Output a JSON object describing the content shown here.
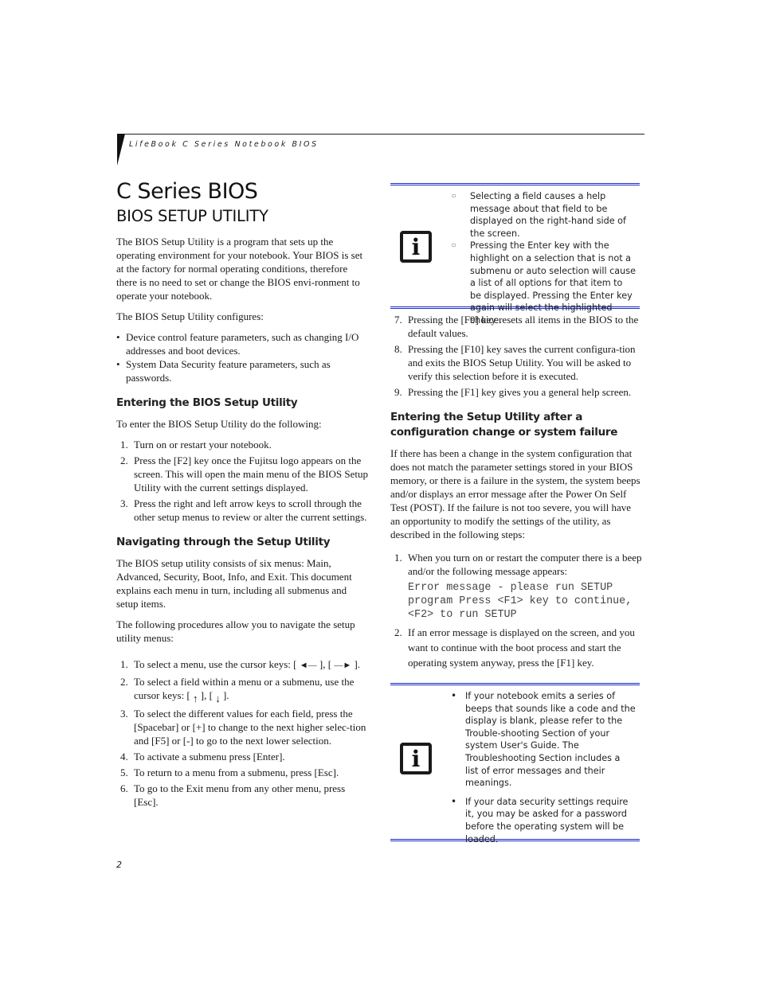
{
  "running_head": "LifeBook C Series Notebook BIOS",
  "page_title": "C Series BIOS",
  "section_title": "BIOS SETUP UTILITY",
  "intro": {
    "p1": "The BIOS Setup Utility is a program that sets up the operating environment for your notebook. Your BIOS is set at the factory for normal operating conditions, therefore there is no need to set or change the BIOS envi-ronment to operate your notebook.",
    "p2": "The BIOS Setup Utility configures:",
    "bullets": [
      "Device control feature parameters, such as changing I/O addresses and boot devices.",
      "System Data Security feature parameters, such as passwords."
    ]
  },
  "entering": {
    "heading": "Entering the BIOS Setup Utility",
    "intro": "To enter the BIOS Setup Utility do the following:",
    "steps": [
      {
        "num": "1.",
        "text": "Turn on or restart your notebook."
      },
      {
        "num": "2.",
        "text": "Press the [F2] key once the Fujitsu logo appears on the screen. This will open the main menu of the BIOS Setup Utility with the current settings displayed."
      },
      {
        "num": "3.",
        "text": "Press the right and left arrow keys to scroll through the other setup menus to review or alter the current settings."
      }
    ]
  },
  "navigating": {
    "heading": "Navigating through the Setup Utility",
    "p1": "The BIOS setup utility consists of six menus: Main, Advanced, Security, Boot, Info, and Exit. This document explains each menu in turn, including all submenus and setup items.",
    "p2": "The following procedures allow you to navigate the setup utility menus:",
    "step1": {
      "num": "1.",
      "text_a": "To select a menu, use the cursor keys: [ ",
      "mid": " ], [ ",
      "text_b": " ]."
    },
    "step2": {
      "num": "2.",
      "text_a": "To select a field within a menu or a submenu, use the cursor keys: [ ",
      "mid": " ], [ ",
      "text_b": " ]."
    },
    "steps": [
      {
        "num": "3.",
        "text": "To select the different values for each field, press the [Spacebar] or [+] to change to the next higher selec-tion and [F5] or [-] to go to the next lower selection."
      },
      {
        "num": "4.",
        "text": "To activate a submenu press [Enter]."
      },
      {
        "num": "5.",
        "text": "To return to a menu from a submenu, press [Esc]."
      },
      {
        "num": "6.",
        "text": "To go to the Exit menu from any other menu, press [Esc]."
      },
      {
        "num": "7.",
        "text": "Pressing the [F9] key resets all items in the BIOS to the default values."
      },
      {
        "num": "8.",
        "text": "Pressing the [F10] key saves the current configura-tion and exits the BIOS Setup Utility. You will be asked to verify this selection before it is executed."
      },
      {
        "num": "9.",
        "text": "Pressing the [F1] key gives you a general help screen."
      }
    ],
    "arrows": {
      "left": "◄—",
      "right": "—►",
      "up": "↑",
      "down": "↓"
    }
  },
  "note1": {
    "icon": "info-icon",
    "icon_glyph": "i",
    "items": [
      "Selecting a field causes a help message about that field to be displayed on the right-hand side of the screen.",
      "Pressing the Enter key with the highlight on a selection that is not a submenu or auto selection will cause a list of all options for that item to be displayed. Pressing the Enter key again will select the highlighted choice."
    ]
  },
  "failure": {
    "heading": "Entering the Setup Utility after a configuration change or system failure",
    "p1": "If there has been a change in the system configuration that does not match the parameter settings stored in your BIOS memory, or there is a failure in the system, the system beeps and/or displays an error message after the Power On Self Test (POST). If the failure is not too severe, you will have an opportunity to modify the settings of the utility, as described in the following steps:",
    "steps": [
      {
        "num": "1.",
        "text": "When you turn on or restart the computer there is a beep and/or the following message appears:"
      },
      {
        "num": "2.",
        "text": "If an error message is displayed on the screen, and you want to continue with the boot process and start the operating system anyway, press the [F1] key."
      }
    ],
    "error_message": "Error message - please run SETUP\nprogram Press <F1> key to continue,\n<F2> to run SETUP"
  },
  "note2": {
    "icon": "info-icon",
    "icon_glyph": "i",
    "items": [
      "If your notebook emits a series of beeps that sounds like a code and the display is blank, please refer to the Trouble-shooting Section of your system User's Guide. The Troubleshooting Section includes a list of error messages and their meanings.",
      "If your data security settings require it, you may be asked for a password before the operating system will be loaded."
    ]
  },
  "page_number": "2",
  "colors": {
    "note_rule": "#1b2ec8",
    "text": "#1a1a1a"
  }
}
